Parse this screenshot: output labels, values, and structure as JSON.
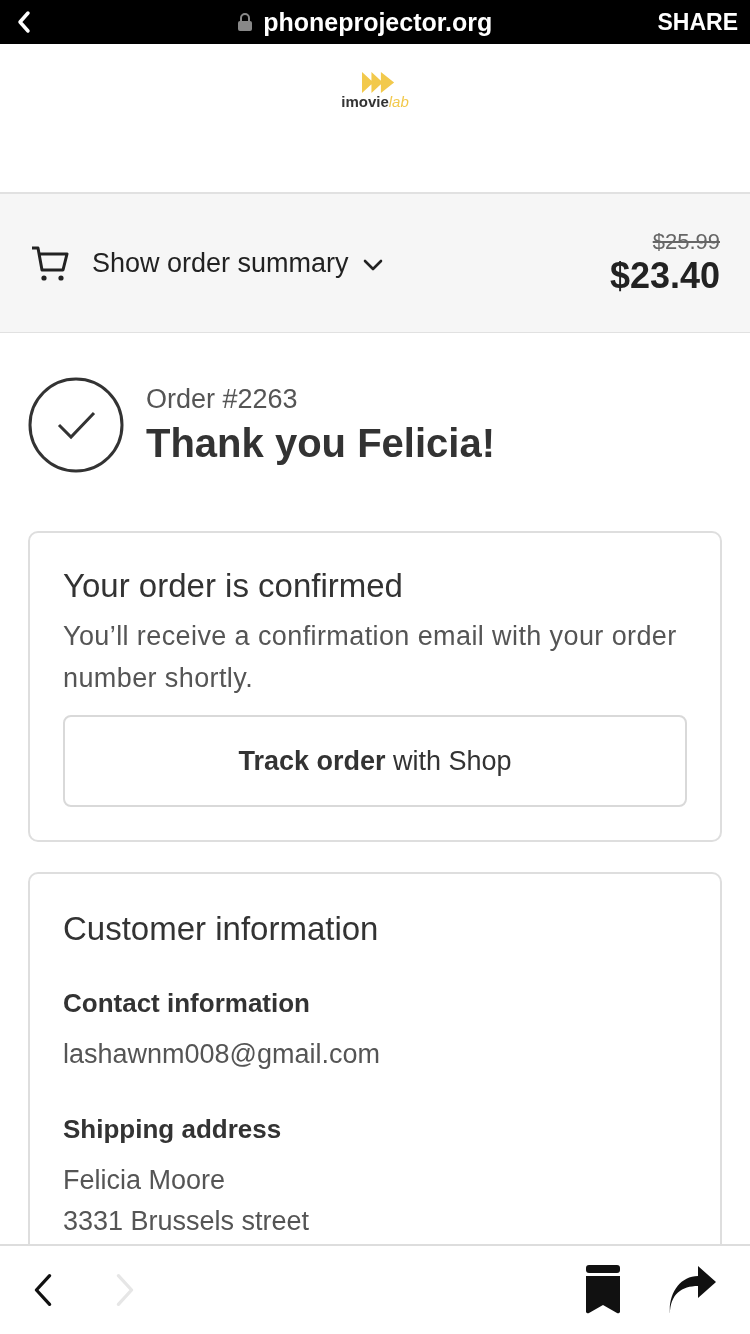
{
  "browser_bar": {
    "url": "phoneprojector.org",
    "action": "SHARE"
  },
  "logo": {
    "name": "imovie",
    "suffix": "lab"
  },
  "order_summary": {
    "label": "Show order summary",
    "expanded": false,
    "original_price": "$25.99",
    "price": "$23.40"
  },
  "order": {
    "number": "Order #2263",
    "greeting": "Thank you Felicia!"
  },
  "confirmation": {
    "title": "Your order is confirmed",
    "message": "You’ll receive a confirmation email with your order number shortly.",
    "button": "**Track order** with Shop"
  },
  "customer": {
    "title": "Customer information",
    "sections": [
      {
        "heading": "Contact information",
        "lines": [
          "lashawnm008@gmail.com"
        ]
      },
      {
        "heading": "Shipping address",
        "lines": [
          "Felicia Moore",
          "3331 Brussels street"
        ]
      }
    ]
  },
  "toolbar": {
    "back_disabled": false,
    "forward_disabled": true
  }
}
